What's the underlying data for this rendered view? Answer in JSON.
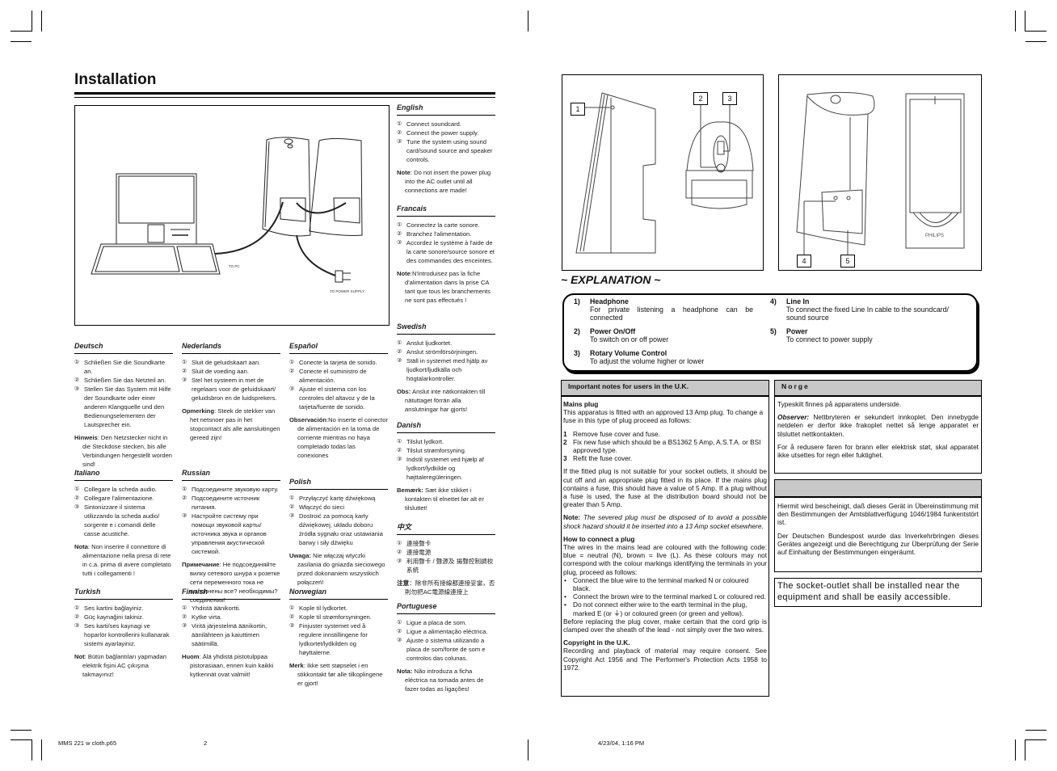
{
  "page": {
    "title": "Installation",
    "footer": {
      "file": "MMS 221 w cloth.p65",
      "page": "2",
      "timestamp": "4/23/04, 1:16 PM"
    }
  },
  "illustration": {
    "label_pc": "TO PC",
    "label_power": "TO POWER SUPPLY"
  },
  "languages": [
    {
      "name": "English",
      "steps": [
        "Connect soundcard.",
        "Connect the power supply.",
        "Tune the system using sound card/sound source and speaker controls."
      ],
      "note_label": "Note",
      "note": ": Do not insert the power plug into the AC outlet until all connections are made!"
    },
    {
      "name": "Francais",
      "steps": [
        "Connectez la carte sonore.",
        "Branchez l'alimentation.",
        "Accordez le système à l'aide de la carte sonore/source sonore et des commandes des enceintes."
      ],
      "note_label": "Note",
      "note": ":N'introduisez pas la fiche d'alimentation dans la prise CA tant que tous les branchements ne sont pas effectués !"
    },
    {
      "name": "Swedish",
      "steps": [
        "Anslut ljudkortet.",
        "Anslut strömförsörjningen.",
        "Ställ in systemet med hjälp av ljudkort/ljudkälla och högtalarkontroller."
      ],
      "note_label": "Obs:",
      "note": " Anslut inte nätkontakten till nätuttaget förrän alla anslutningar har gjorts!"
    },
    {
      "name": "Danish",
      "steps": [
        "Tilslut lydkort.",
        "Tilslut strømforsyning.",
        "Indstil systemet ved hjælp af lydkort/lydkilde og højttaleregüleringen."
      ],
      "note_label": "Bemærk:",
      "note": " Sæt ikke stikket i kontakten til elnettet før alt er tilsluttet!"
    },
    {
      "name": "中文",
      "steps": [
        "連接聲卡",
        "連接電源",
        "利用聲卡 / 聲源及 揚聲控制調校系統"
      ],
      "note_label": "注意",
      "note": "：除非所有接線都連接妥當，否則勿把AC電源線連接上"
    },
    {
      "name": "Portuguese",
      "steps": [
        "Ligue a placa de som.",
        "Ligue a alimentação eléctrica.",
        "Ajuste o sistema utilizando a placa de som/fonte de som e controlos das colunas."
      ],
      "note_label": "Nota:",
      "note": " Não introduza a ficha eléctrica na tomada antes de fazer todas as ligações!"
    },
    {
      "name": "Deutsch",
      "steps": [
        "Schließen Sie die Soundkarte an.",
        "Schließen Sie das Netzteil an.",
        "Stellen Sie das System mit Hilfe der Soundkarte oder einer anderen Klangquelle und den Bedienungselementen der Lautsprecher ein."
      ],
      "note_label": "Hinweis",
      "note": ": Den Netzstecker nicht in die Steckdose stecken, bis alle Verbindungen hergestellt worden sind!"
    },
    {
      "name": "Nederlands",
      "steps": [
        "Sluit de geluidskaart aan.",
        "Sluit de voeding aan.",
        "Stel het systeem in met de regelaars voor de geluidskaart/ geluidsbron en de luidsprekers."
      ],
      "note_label": "Opmerking",
      "note": ": Steek de stekker van het netsnoer pas in het stopcontact als alle aansluitingen gereed zijn!"
    },
    {
      "name": "Español",
      "steps": [
        "Conecte la tarjeta de sonido.",
        "Conecte el suministro de alimentación.",
        "Ajuste el sistema con los controles del altavoz y de la tarjeta/fuente de sonido."
      ],
      "note_label": "Observación",
      "note": ":No inserte el conector de alimentación en la toma de corriente mientras no haya completado todas las conexiones"
    },
    {
      "name": "Italiano",
      "steps": [
        "Collegare la scheda audio.",
        "Collegare l'alimentazione.",
        "Sintonizzare il sistema utilizzando la scheda audio/ sorgente e i comandi delle casse acustiche."
      ],
      "note_label": "Nota",
      "note": ": Non inserire il connettore di alimentazione nella presa di rete in c.a. prima di avere completato tutti i collegamenti !"
    },
    {
      "name": "Russian",
      "steps": [
        "Подсоедините звуковую карту.",
        "Подсоедините источник питания.",
        "Настройте систему при помощи звуковой карты/источника звука и органов управления акустической системой."
      ],
      "note_label": "Примечание",
      "note": ": Не подсоединяйте вилку сетевого шнура к розетке сети переменного тока не выполнены все? необходимы? соединения!"
    },
    {
      "name": "Polish",
      "steps": [
        "Przyłączyć kartę dźwiękową",
        "Włączyć do sieci",
        "Dostroić za pomocą karty dźwiękowej, układu doboru źródła sygnału oraz ustawiania barwy i siły dźwięku"
      ],
      "note_label": "Uwaga:",
      "note": " Nie włączaj wtyczki zasilania do gniazda sieciowego przed dokonaniem wszystkich połączeń!"
    },
    {
      "name": "Turkish",
      "steps": [
        "Ses kartini bağlayiniz.",
        "Güç kaynağini takiniz.",
        "Ses karti/ses kaynagi ve hoparlör kontrollerini kullanarak sistemi ayarlayiniz."
      ],
      "note_label": "Not",
      "note": ": Bütün bağlantıları yapmadan elektrik fişini AC çıkışına takmayınız!"
    },
    {
      "name": "Finnish",
      "steps": [
        "Yhdistä äänikortti.",
        "Kytke virta.",
        "Viritä järjestelmä äänikortin, äänilähteen ja kaiuttimen säätimillä."
      ],
      "note_label": "Huom",
      "note": ": Älä yhdistä pistotulppaa pistorasiaan, ennen kuin kaikki kytkennät ovat valmiit!"
    },
    {
      "name": "Norwegian",
      "steps": [
        "Kople til lydkortet.",
        "Kople til strømforsyningen.",
        "Finjuster systemet ved å regulere innstillingene for lydkortet/lydkilden og høyttalerne."
      ],
      "note_label": "Merk",
      "note": ": Ikke sett støpselet i en stikkontakt før alle tilkoplingene er gjort!"
    }
  ],
  "step_markers": [
    "①",
    "②",
    "③"
  ],
  "figures": {
    "callouts": [
      "1",
      "2",
      "3",
      "4",
      "5"
    ],
    "brand": "PHILIPS"
  },
  "explanation": {
    "title": "~ EXPLANATION ~",
    "items": [
      {
        "num": "1)",
        "title": "Headphone",
        "desc": "For private listening a headphone can be connected"
      },
      {
        "num": "2)",
        "title": "Power On/Off",
        "desc": "To switch on or off power"
      },
      {
        "num": "3)",
        "title": "Rotary Volume Control",
        "desc": "To adjust the volume higher or lower"
      },
      {
        "num": "4)",
        "title": "Line In",
        "desc": "To connect the fixed Line In cable to the soundcard/ sound source"
      },
      {
        "num": "5)",
        "title": "Power",
        "desc": "To connect to power supply"
      }
    ]
  },
  "uk_notes": {
    "header": "Important notes for users in the U.K.",
    "mains_title": "Mains plug",
    "mains_intro": "This apparatus is fitted with an approved 13 Amp plug. To change a fuse in this type of plug proceed as follows:",
    "steps": [
      {
        "n": "1",
        "text": "Remove fuse cover and fuse."
      },
      {
        "n": "2",
        "text": "Fix new fuse which should be a BS1362 5 Amp, A.S.T.A. or BSI approved type."
      },
      {
        "n": "3",
        "text": "Refit the fuse cover."
      }
    ],
    "fitted_plug": "If the fitted plug is not suitable for your socket outlets, it should be cut off and an appropriate plug fitted in its place. If the mains plug contains a fuse, this should have a value of 5 Amp. If a plug without a fuse is used, the fuse at the distribution board should not be greater than 5 Amp.",
    "note_label": "Note:",
    "note": "The severed plug must be disposed of to avoid a possible shock hazard should it be inserted into a 13 Amp socket elsewhere.",
    "connect_title": "How to connect a plug",
    "connect_intro": "The wires in the mains lead are coloured with the following code: blue = neutral (N), brown = live (L). As these colours may not correspond with the colour markings identifying the terminals in your plug, proceed as follows:",
    "bullets": [
      "Connect the blue wire to the terminal marked N or coloured black.",
      "Connect the brown wire to the terminal marked L or coloured red.",
      "Do not connect either wire to the earth terminal in the plug, marked E (or ⏚) or coloured green (or green and yellow)."
    ],
    "before_replacing": "Before replacing the plug cover, make certain that the cord grip is clamped over the sheath of the lead - not simply over the two wires.",
    "copyright_title": "Copyright in the U.K.",
    "copyright": "Recording and playback of material may require consent. See Copyright Act 1956 and The Performer's Protection Acts 1958 to 1972."
  },
  "norge": {
    "header": "Norge",
    "p1": "Typeskilt finnes på apparatens underside.",
    "observer_label": "Observer:",
    "p2": " Nettbryteren er sekundert innkoplet. Den innebygde netdelen er derfor ikke frakoplet nettet så lenge apparatet er tilsluttet nettkontakten.",
    "p3": "For å redusere faren for brann eller elektrisk støt, skal apparatet ikke utsettes for regn eller fuktighet."
  },
  "german_notice": {
    "header": "",
    "p1": "Hiermit wird bescheinigt, daß dieses Gerät in Übereinstimmung mit den Bestimmungen der Amtsblattverfügung 1046/1984 funkentstört ist.",
    "p2": "Der Deutschen Bundespost wurde das Inverkehrbringen dieses Gerätes angezeigt und die Berechtigung zur Überprüfung der Serie auf Einhaltung der Bestimmungen eingeräumt."
  },
  "socket_notice": "The socket-outlet shall be installed near the equipment and shall be easily accessible."
}
